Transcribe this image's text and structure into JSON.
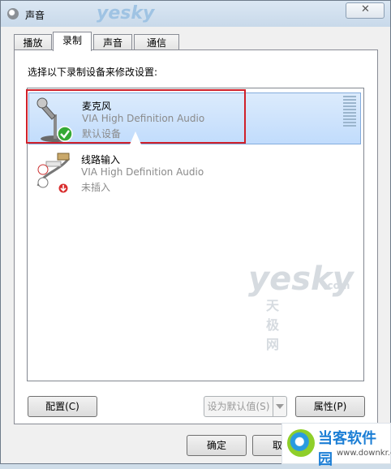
{
  "window": {
    "title": "声音",
    "close_label": "✕",
    "icon": "speaker-icon"
  },
  "tabs": [
    {
      "label": "播放",
      "active": false
    },
    {
      "label": "录制",
      "active": true
    },
    {
      "label": "声音",
      "active": false
    },
    {
      "label": "通信",
      "active": false
    }
  ],
  "instruction": "选择以下录制设备来修改设置:",
  "devices": [
    {
      "name": "麦克风",
      "driver": "VIA High Definition Audio",
      "status": "默认设备",
      "selected": true,
      "icon": "microphone-icon",
      "status_icon": "check-badge-icon"
    },
    {
      "name": "线路输入",
      "driver": "VIA High Definition Audio",
      "status": "未插入",
      "selected": false,
      "icon": "line-in-cable-icon",
      "status_icon": "unplugged-badge-icon"
    }
  ],
  "buttons": {
    "configure": "配置(C)",
    "set_default": "设为默认值(S)",
    "properties": "属性(P)",
    "ok": "确定",
    "cancel": "取"
  },
  "watermark": {
    "brand": "yesky",
    "brand_cn": "天极网",
    "suffix": ".com",
    "title_brand": "yesky"
  },
  "footer_badge": {
    "title": "当客软件园",
    "url": "www.downkr.com"
  },
  "colors": {
    "selection": "#c1dcfc",
    "highlight_border": "#d0202a",
    "check_green": "#35a935",
    "unplug_red": "#d93030"
  }
}
